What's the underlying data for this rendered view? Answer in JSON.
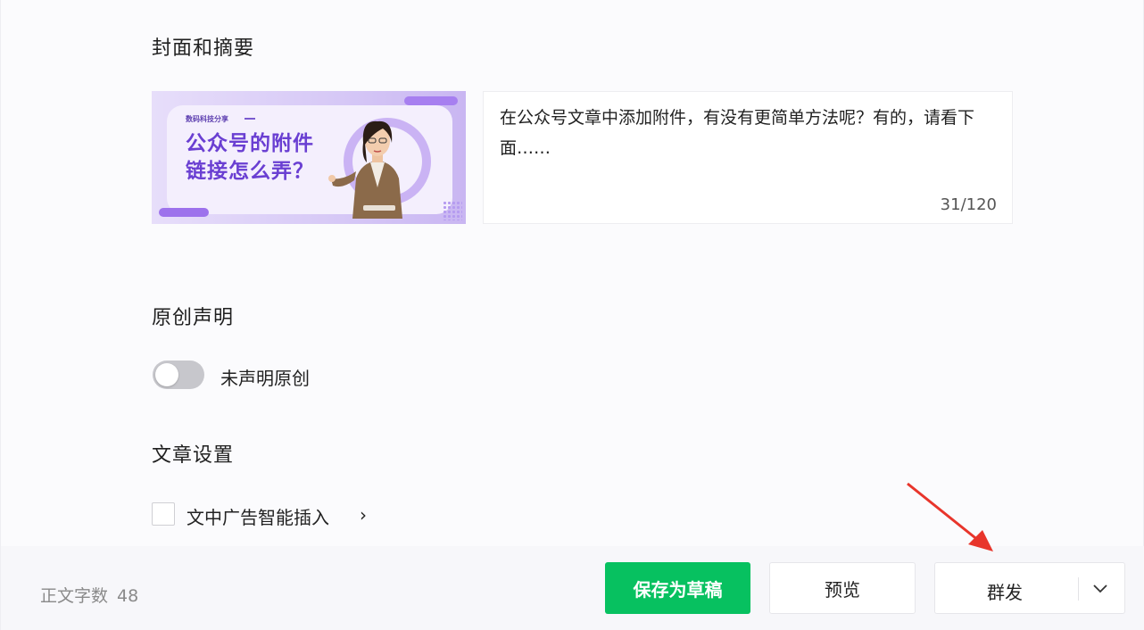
{
  "sections": {
    "cover_title": "封面和摘要",
    "original_title": "原创声明",
    "settings_title": "文章设置"
  },
  "cover": {
    "tag": "数码科技分享",
    "headline_line1": "公众号的附件",
    "headline_line2": "链接怎么弄？"
  },
  "summary": {
    "text": "在公众号文章中添加附件，有没有更简单方法呢？有的，请看下面……",
    "count": "31/120"
  },
  "original": {
    "toggle_label": "未声明原创",
    "toggle_on": false
  },
  "settings": {
    "ad_label": "文中广告智能插入",
    "ad_checked": false,
    "chevron": "›"
  },
  "footer": {
    "wordcount_label": "正文字数",
    "wordcount_value": "48",
    "save_label": "保存为草稿",
    "preview_label": "预览",
    "publish_label": "群发"
  },
  "colors": {
    "accent_green": "#07c160",
    "cover_purple": "#6a3fd2",
    "annotation_red": "#e8352b"
  },
  "icons": {
    "dropdown": "chevron-down-icon",
    "annotation": "red-arrow-icon"
  }
}
